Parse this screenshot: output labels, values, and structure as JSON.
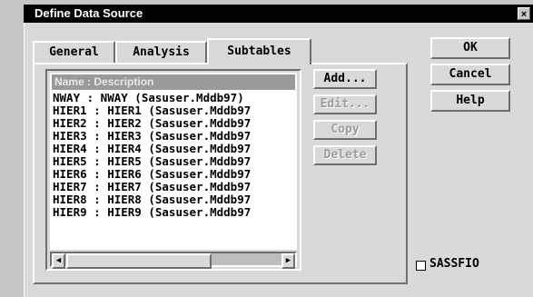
{
  "window": {
    "title": "Define Data Source",
    "close_glyph": "×"
  },
  "tabs": [
    {
      "label": "General"
    },
    {
      "label": "Analysis"
    },
    {
      "label": "Subtables"
    }
  ],
  "active_tab": "Subtables",
  "list": {
    "header": "Name : Description",
    "items": [
      "NWAY : NWAY (Sasuser.Mddb97)",
      "HIER1 : HIER1 (Sasuser.Mddb97",
      "HIER2 : HIER2 (Sasuser.Mddb97",
      "HIER3 : HIER3 (Sasuser.Mddb97",
      "HIER4 : HIER4 (Sasuser.Mddb97",
      "HIER5 : HIER5 (Sasuser.Mddb97",
      "HIER6 : HIER6 (Sasuser.Mddb97",
      "HIER7 : HIER7 (Sasuser.Mddb97",
      "HIER8 : HIER8 (Sasuser.Mddb97",
      "HIER9 : HIER9 (Sasuser.Mddb97"
    ]
  },
  "list_actions": {
    "add": "Add...",
    "edit": "Edit...",
    "copy": "Copy",
    "delete": "Delete"
  },
  "dialog_buttons": {
    "ok": "OK",
    "cancel": "Cancel",
    "help": "Help"
  },
  "checkbox": {
    "label": "SASSFIO",
    "checked": false
  },
  "scrollbar": {
    "left_arrow": "◀",
    "right_arrow": "▶"
  },
  "colors": {
    "titlebar": "#000000",
    "dialog_bg": "#d9d9d9",
    "list_header_bg": "#9a9a9a",
    "disabled_text": "#9d9d9d"
  }
}
